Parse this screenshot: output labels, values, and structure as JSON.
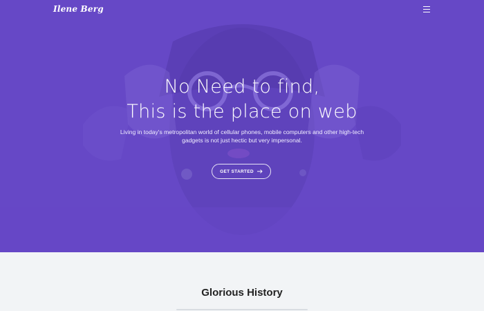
{
  "nav": {
    "logo": "Ilene Berg",
    "menu_icon": "hamburger-menu-icon"
  },
  "hero": {
    "title_line1": "No Need to find,",
    "title_line2": "This is the place on web",
    "description": "Living in today's metropolitan world of cellular phones, mobile computers and other high-tech gadgets is not just hectic but very impersonal.",
    "cta_label": "GET STARTED",
    "cta_icon": "arrow-right-icon",
    "background_color": "#6648c6"
  },
  "section": {
    "title": "Glorious History"
  }
}
